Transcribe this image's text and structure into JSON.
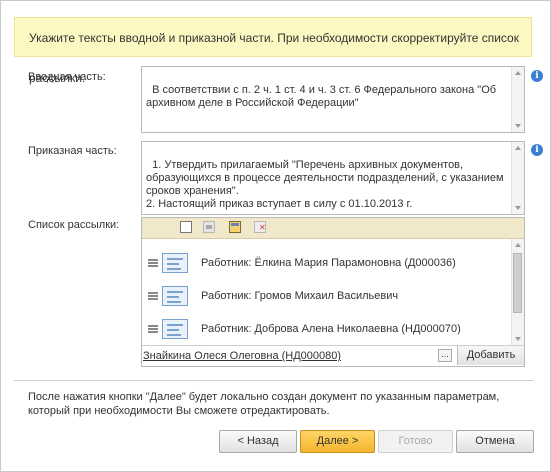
{
  "banner": "Укажите тексты вводной и приказной части. При необходимости скорректируйте список рассылки.",
  "intro": {
    "label": "Вводная часть:",
    "text": "В соответствии с п. 2 ч. 1 ст. 4 и ч. 3 ст. 6 Федерального закона \"Об архивном деле в Российской Федерации\""
  },
  "order": {
    "label": "Приказная часть:",
    "text": "1. Утвердить прилагаемый \"Перечень архивных документов, образующихся в процессе деятельности подразделений, с указанием сроков хранения\".\n2. Настоящий приказ вступает в силу с 01.10.2013 г."
  },
  "mailing": {
    "label": "Список рассылки:",
    "items": [
      "Работник: Ёлкина Мария Парамоновна (Д000036)",
      "Работник: Громов Михаил Васильевич",
      "Работник: Доброва Алена Николаевна (НД000070)"
    ],
    "selected_person": "Знайкина Олеся Олеговна (НД000080)",
    "more_label": "...",
    "add_label": "Добавить"
  },
  "note": "После нажатия кнопки \"Далее\" будет локально создан документ по указанным параметрам, который при необходимости Вы сможете отредактировать.",
  "buttons": {
    "back": "< Назад",
    "next": "Далее >",
    "done": "Готово",
    "cancel": "Отмена"
  },
  "info_glyph": "i",
  "colors": {
    "banner_bg": "#fbf8c2",
    "next_button": "#f5b52d",
    "info_icon": "#3c7fd1",
    "toolbar_bg": "#f1e7c9"
  }
}
